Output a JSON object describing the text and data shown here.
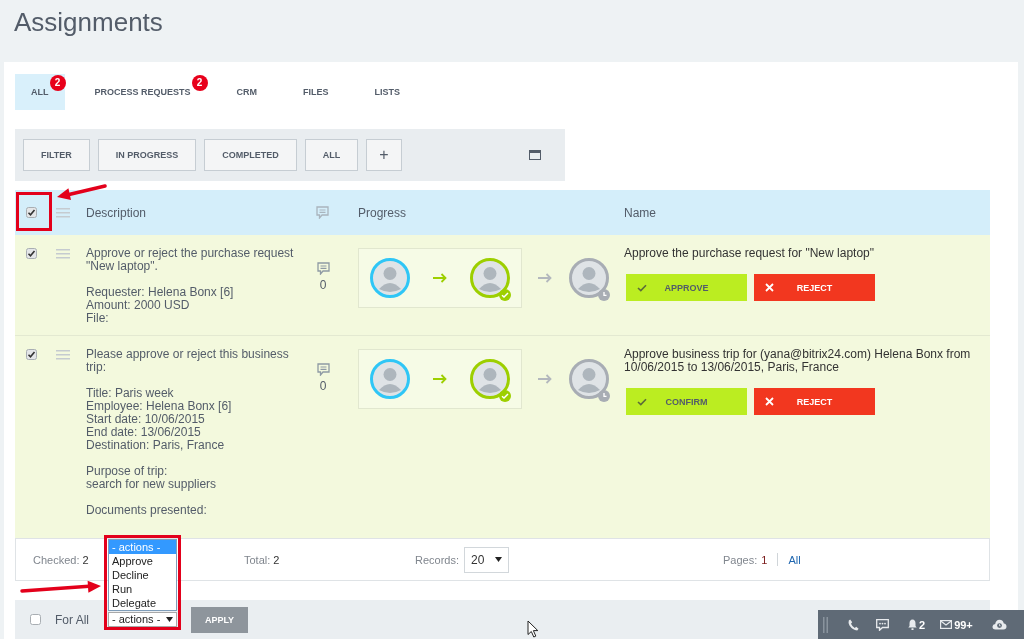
{
  "page": {
    "title": "Assignments"
  },
  "tabs": [
    {
      "label": "ALL",
      "badge": "2",
      "selected": true
    },
    {
      "label": "PROCESS REQUESTS",
      "badge": "2",
      "selected": false
    },
    {
      "label": "CRM",
      "selected": false
    },
    {
      "label": "FILES",
      "selected": false
    },
    {
      "label": "LISTS",
      "selected": false
    }
  ],
  "filter_bar": {
    "buttons": [
      {
        "label": "FILTER",
        "kind": "text"
      },
      {
        "label": "IN PROGRESS",
        "kind": "text"
      },
      {
        "label": "COMPLETED",
        "kind": "text"
      },
      {
        "label": "ALL",
        "kind": "text"
      },
      {
        "label": "+",
        "kind": "add"
      }
    ]
  },
  "table": {
    "select_all_checked": true,
    "columns": [
      "Description",
      "Progress",
      "Name"
    ],
    "rows": [
      {
        "checked": true,
        "description": [
          [
            "Approve or reject the purchase request \"New laptop\"."
          ],
          [
            "Requester: Helena Bonx [6]",
            "Amount: 2000 USD",
            "File:"
          ]
        ],
        "comments": "0",
        "progress": [
          {
            "kind": "started"
          },
          {
            "kind": "approved"
          },
          {
            "kind": "waiting"
          }
        ],
        "name": "Approve the purchase request for \"New laptop\"",
        "actions": [
          {
            "kind": "approve",
            "label": "APPROVE"
          },
          {
            "kind": "reject",
            "label": "REJECT"
          }
        ]
      },
      {
        "checked": true,
        "description": [
          [
            "Please approve or reject this business trip:"
          ],
          [
            "Title: Paris week",
            "Employee: Helena Bonx [6]",
            "Start date: 10/06/2015",
            "End date: 13/06/2015",
            "Destination: Paris, France"
          ],
          [
            "Purpose of trip:",
            "search for new suppliers"
          ],
          [
            "Documents presented:"
          ]
        ],
        "comments": "0",
        "progress": [
          {
            "kind": "started"
          },
          {
            "kind": "approved"
          },
          {
            "kind": "waiting"
          }
        ],
        "name": "Approve business trip for (yana@bitrix24.com) Helena Bonx from 10/06/2015 to 13/06/2015, Paris, France",
        "actions": [
          {
            "kind": "approve",
            "label": "CONFIRM"
          },
          {
            "kind": "reject",
            "label": "REJECT"
          }
        ]
      }
    ]
  },
  "footer": {
    "checked": {
      "label": "Checked:",
      "value": "2"
    },
    "total": {
      "label": "Total:",
      "value": "2"
    },
    "records": {
      "label": "Records:",
      "value": "20"
    },
    "pages": {
      "label": "Pages:",
      "links": [
        {
          "label": "1",
          "selected": true
        },
        {
          "label": "All",
          "selected": false
        }
      ]
    }
  },
  "bulk_actions": {
    "for_all": {
      "label": "For All",
      "checked": false
    },
    "select": {
      "value": "- actions -",
      "expanded": true,
      "options": [
        {
          "label": "- actions -",
          "selected": true
        },
        {
          "label": "Approve",
          "selected": false
        },
        {
          "label": "Decline",
          "selected": false
        },
        {
          "label": "Run",
          "selected": false
        },
        {
          "label": "Delegate",
          "selected": false
        }
      ]
    },
    "apply": "APPLY"
  },
  "taskbar": {
    "notifications": "2",
    "messages": "99+"
  }
}
